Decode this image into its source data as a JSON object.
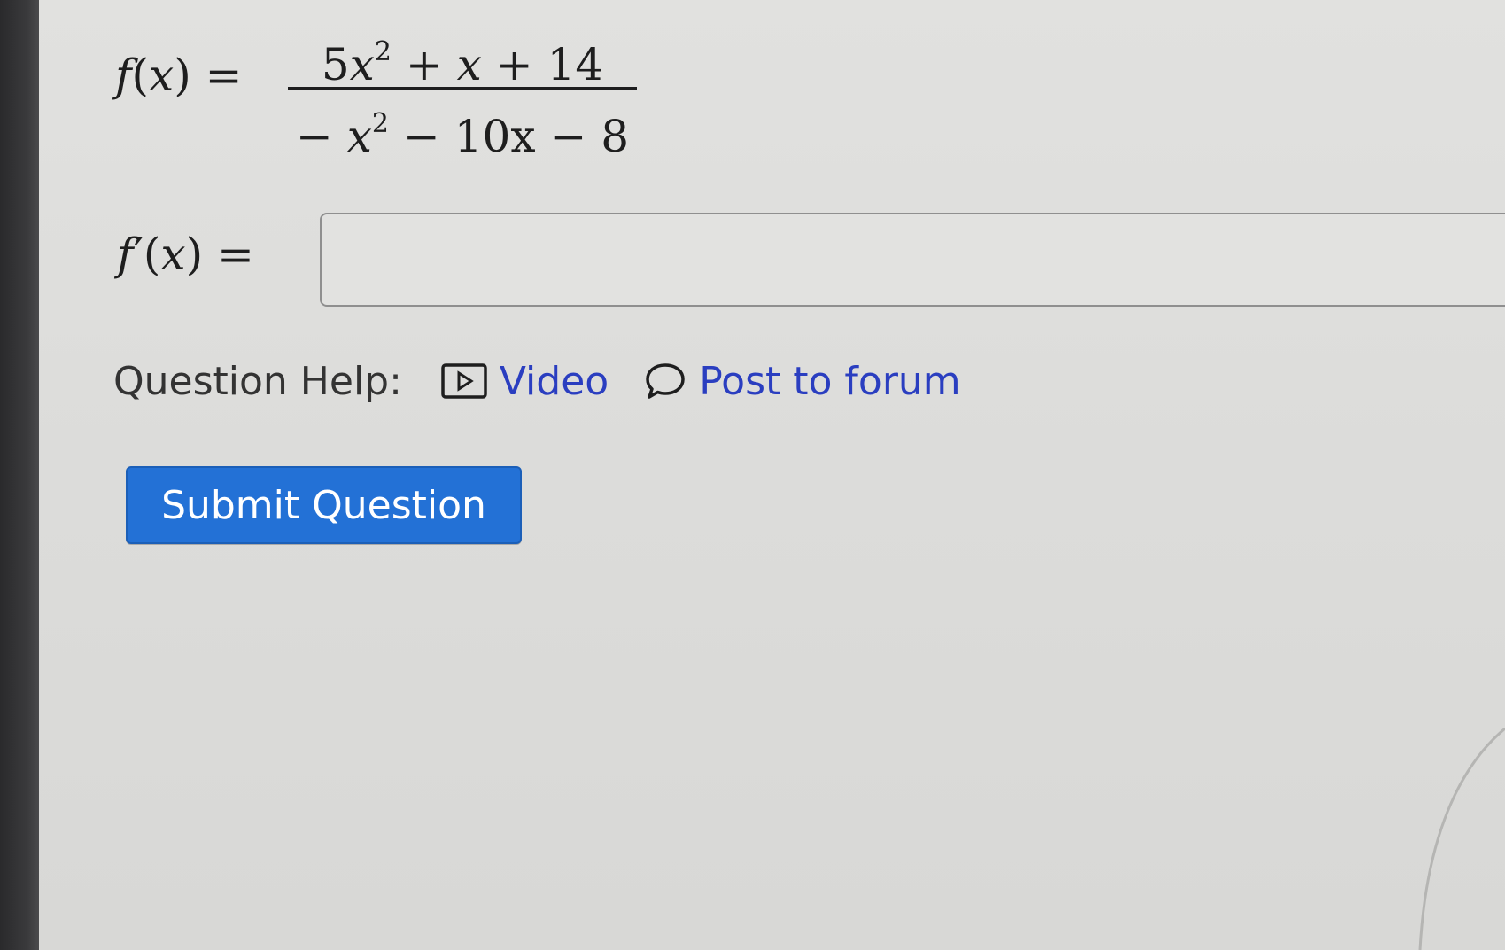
{
  "question": {
    "function_label": "f(x) =",
    "numerator": {
      "coef": "5",
      "var": "x",
      "exp": "2",
      "rest_plus1": "+",
      "term2": "x",
      "rest_plus2": "+",
      "const": "14"
    },
    "denominator": {
      "minus1": "−",
      "var": "x",
      "exp": "2",
      "minus2": "−",
      "term2": "10x",
      "minus3": "−",
      "const": "8"
    },
    "derivative_label": "f′(x) ="
  },
  "answer": {
    "value": "",
    "placeholder": ""
  },
  "help": {
    "label": "Question Help:",
    "video_label": "Video",
    "forum_label": "Post to forum",
    "video_icon": "play-box-icon",
    "forum_icon": "speech-bubble-icon",
    "link_color": "#2a3ec0"
  },
  "submit": {
    "label": "Submit Question",
    "color": "#2371d6"
  }
}
